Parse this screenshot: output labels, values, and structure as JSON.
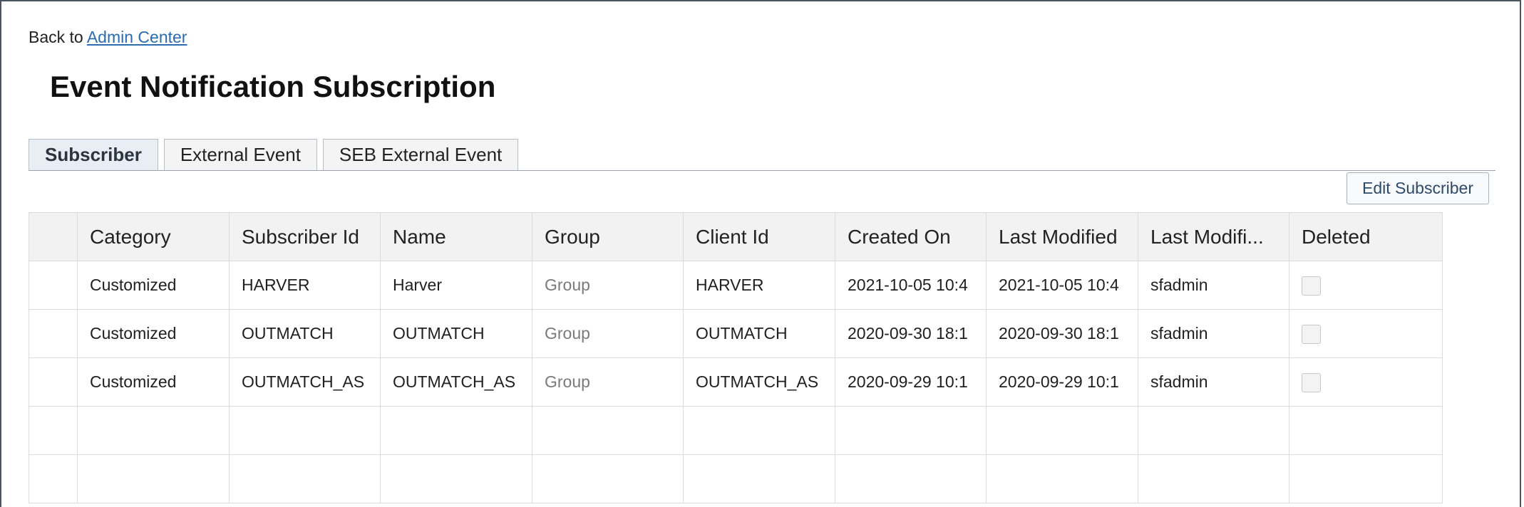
{
  "back": {
    "prefix": "Back to ",
    "link_label": "Admin Center"
  },
  "page": {
    "title": "Event Notification Subscription"
  },
  "tabs": [
    {
      "label": "Subscriber",
      "active": true
    },
    {
      "label": "External Event",
      "active": false
    },
    {
      "label": "SEB External Event",
      "active": false
    }
  ],
  "toolbar": {
    "edit_label": "Edit Subscriber"
  },
  "table": {
    "columns": [
      "",
      "Category",
      "Subscriber Id",
      "Name",
      "Group",
      "Client Id",
      "Created On",
      "Last Modified",
      "Last Modifi...",
      "Deleted"
    ],
    "rows": [
      {
        "category": "Customized",
        "subscriber_id": "HARVER",
        "name": "Harver",
        "group": "Group",
        "client_id": "HARVER",
        "created_on": "2021-10-05 10:4",
        "last_modified": "2021-10-05 10:4",
        "last_modified_by": "sfadmin",
        "deleted": false
      },
      {
        "category": "Customized",
        "subscriber_id": "OUTMATCH",
        "name": "OUTMATCH",
        "group": "Group",
        "client_id": "OUTMATCH",
        "created_on": "2020-09-30 18:1",
        "last_modified": "2020-09-30 18:1",
        "last_modified_by": "sfadmin",
        "deleted": false
      },
      {
        "category": "Customized",
        "subscriber_id": "OUTMATCH_AS",
        "name": "OUTMATCH_AS",
        "group": "Group",
        "client_id": "OUTMATCH_AS",
        "created_on": "2020-09-29 10:1",
        "last_modified": "2020-09-29 10:1",
        "last_modified_by": "sfadmin",
        "deleted": false
      }
    ]
  },
  "colors": {
    "link": "#2b6cb0",
    "header_bg": "#f2f2f2",
    "active_tab_bg": "#e9eef4",
    "frame_border": "#4a5561"
  }
}
